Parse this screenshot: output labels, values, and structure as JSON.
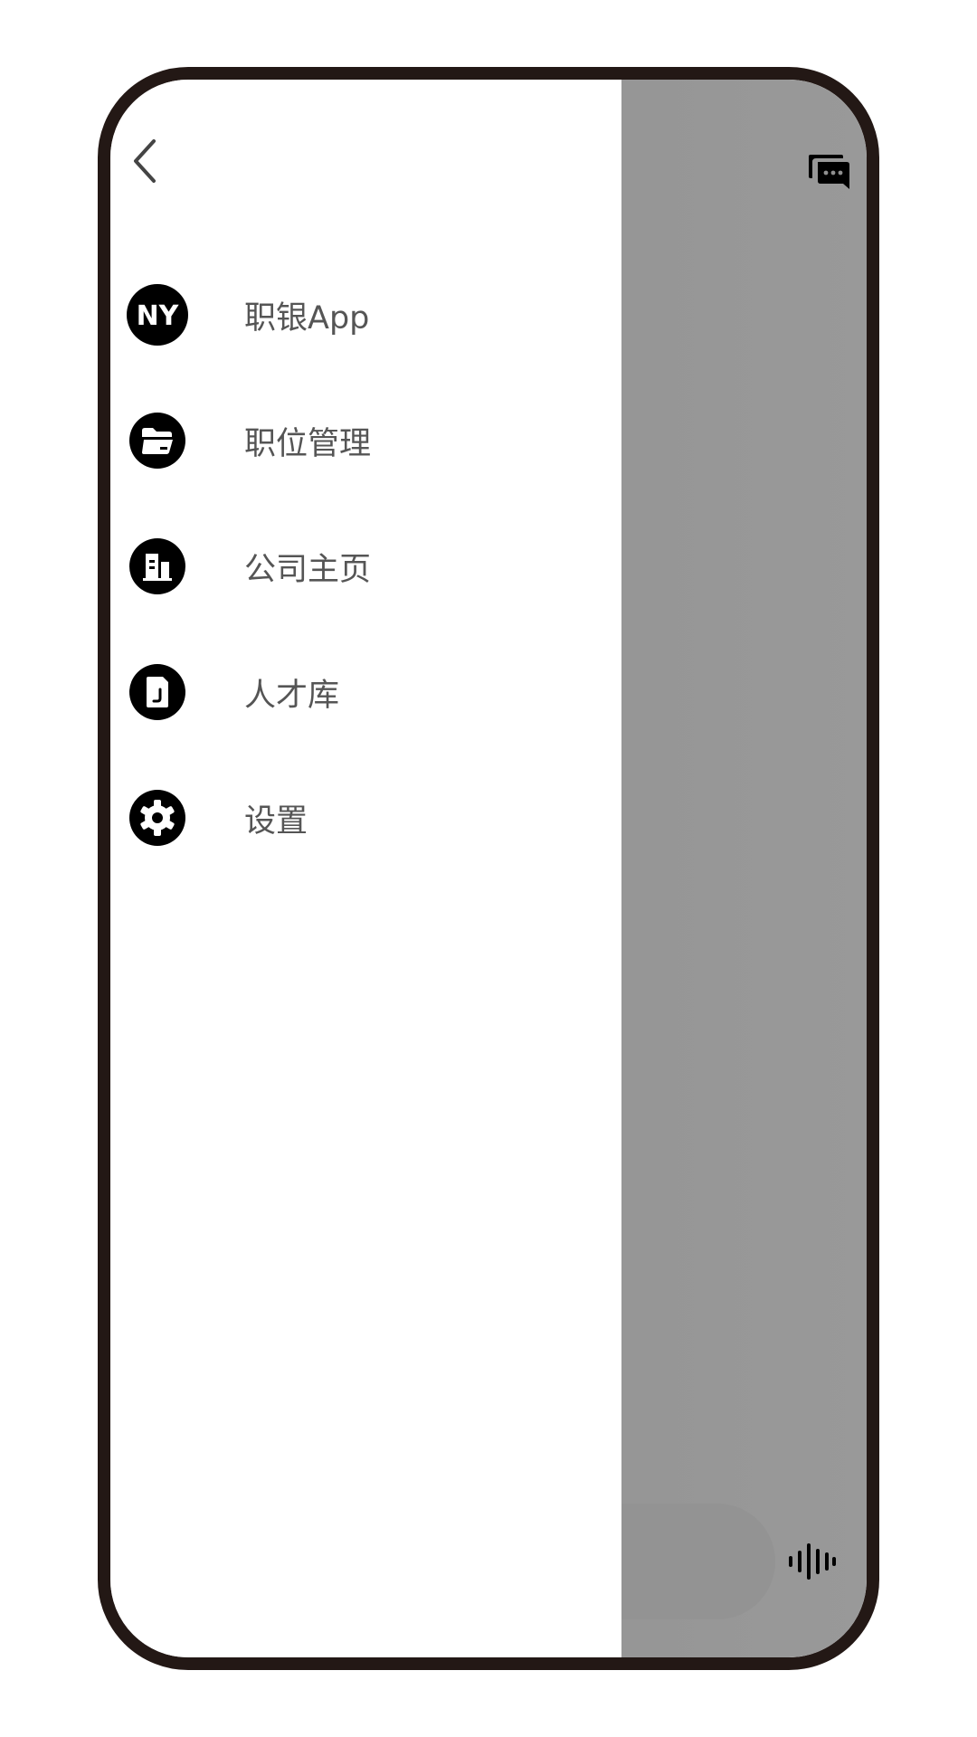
{
  "drawer": {
    "menu": [
      {
        "icon": "app-logo-icon",
        "label": "职银App"
      },
      {
        "icon": "folder-icon",
        "label": "职位管理"
      },
      {
        "icon": "building-icon",
        "label": "公司主页"
      },
      {
        "icon": "document-icon",
        "label": "人才库"
      },
      {
        "icon": "gear-icon",
        "label": "设置"
      }
    ],
    "logo_text": "NY"
  },
  "colors": {
    "frame": "#231815",
    "scrim": "#959595",
    "label": "#555555",
    "icon": "#000000"
  }
}
